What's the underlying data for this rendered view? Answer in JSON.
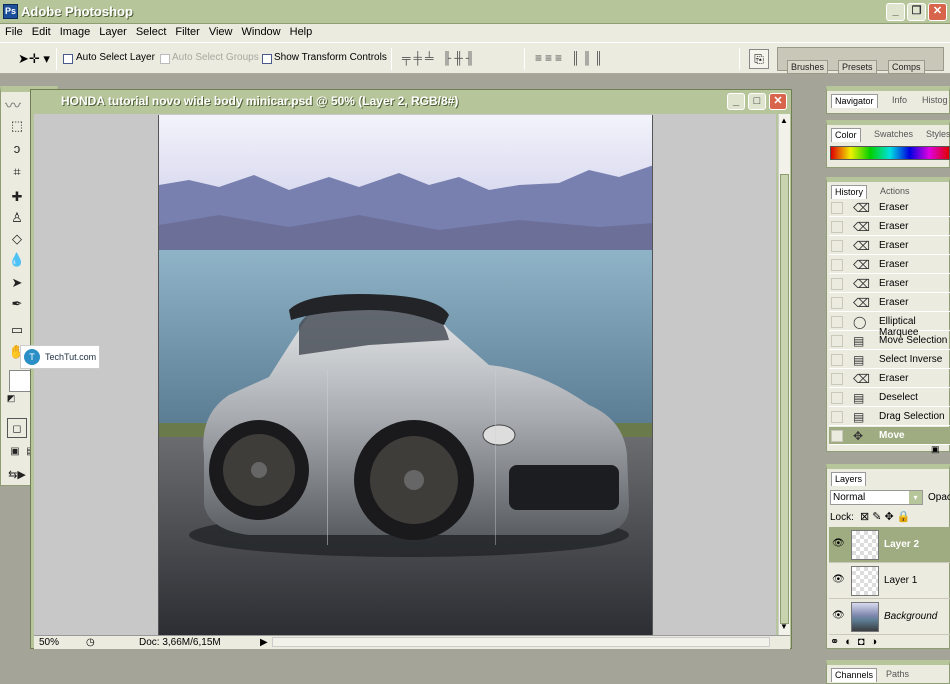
{
  "app": {
    "title": "Adobe Photoshop",
    "icon_letter": "Ps"
  },
  "window_controls": {
    "minimize": "_",
    "restore": "❐",
    "close": "✕"
  },
  "menu": [
    "File",
    "Edit",
    "Image",
    "Layer",
    "Select",
    "Filter",
    "View",
    "Window",
    "Help"
  ],
  "options": {
    "auto_select_layer": "Auto Select Layer",
    "auto_select_groups": "Auto Select Groups",
    "show_transform_controls": "Show Transform Controls",
    "well_tabs": [
      "Brushes",
      "Presets",
      "Comps"
    ]
  },
  "watermark": "TechTut.com",
  "document": {
    "title": "HONDA tutorial novo wide body minicar.psd @ 50% (Layer 2, RGB/8#)",
    "zoom": "50%",
    "doc_size": "Doc: 3,66M/6,15M"
  },
  "panels": {
    "navigator_tabs": [
      "Navigator",
      "Info",
      "Histog"
    ],
    "color_tabs": [
      "Color",
      "Swatches",
      "Styles"
    ],
    "history_tabs": [
      "History",
      "Actions"
    ],
    "history_items": [
      {
        "label": "Eraser",
        "icon": "eraser-icon"
      },
      {
        "label": "Eraser",
        "icon": "eraser-icon"
      },
      {
        "label": "Eraser",
        "icon": "eraser-icon"
      },
      {
        "label": "Eraser",
        "icon": "eraser-icon"
      },
      {
        "label": "Eraser",
        "icon": "eraser-icon"
      },
      {
        "label": "Eraser",
        "icon": "eraser-icon"
      },
      {
        "label": "Elliptical Marquee",
        "icon": "ellipse-icon"
      },
      {
        "label": "Move Selection",
        "icon": "layer-icon"
      },
      {
        "label": "Select Inverse",
        "icon": "layer-icon"
      },
      {
        "label": "Eraser",
        "icon": "eraser-icon"
      },
      {
        "label": "Deselect",
        "icon": "layer-icon"
      },
      {
        "label": "Drag Selection",
        "icon": "layer-icon"
      },
      {
        "label": "Move",
        "icon": "move-icon",
        "active": true
      }
    ],
    "layers_tabs": [
      "Layers"
    ],
    "blend_mode": "Normal",
    "opacity_label": "Opac",
    "lock_label": "Lock:",
    "layers": [
      {
        "name": "Layer 2",
        "active": true
      },
      {
        "name": "Layer 1"
      },
      {
        "name": "Background"
      }
    ],
    "bottom_tabs": [
      "Channels",
      "Paths"
    ]
  }
}
